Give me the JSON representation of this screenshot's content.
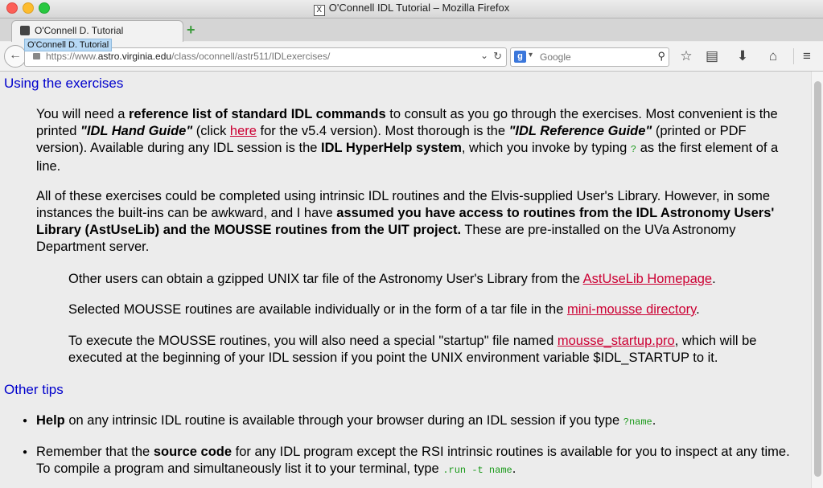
{
  "window": {
    "title": "O'Connell IDL Tutorial – Mozilla Firefox"
  },
  "tab": {
    "label": "O'Connell D. Tutorial",
    "tooltip": "O'Connell D. Tutorial"
  },
  "nav": {
    "url_prefix": "https://www.",
    "url_domain": "astro.virginia.edu",
    "url_path": "/class/oconnell/astr511/IDLexercises/",
    "search_placeholder": "Google"
  },
  "content": {
    "section1_title": "Using the exercises",
    "p1": {
      "a": "You will need a ",
      "b": "reference list of standard IDL commands",
      "c": " to consult as you go through the exercises. Most convenient is the printed ",
      "d": "\"IDL Hand Guide\"",
      "e": " (click ",
      "link": "here",
      "f": " for the v5.4 version). Most thorough is the ",
      "g": "\"IDL Reference Guide\"",
      "h": " (printed or PDF version). Available during any IDL session is the ",
      "i": "IDL HyperHelp system",
      "j": ", which you invoke by typing ",
      "code": "?",
      "k": " as the first element of a line."
    },
    "p2": {
      "a": "All of these exercises could be completed using intrinsic IDL routines and the Elvis-supplied User's Library. However, in some instances the built-ins can be awkward, and I have ",
      "b": "assumed you have access to routines from the IDL Astronomy Users' Library (AstUseLib) and the MOUSSE routines from the UIT project.",
      "c": " These are pre-installed on the UVa Astronomy Department server."
    },
    "s1": {
      "a": "Other users can obtain a gzipped UNIX tar file of the Astronomy User's Library from the ",
      "link": "AstUseLib Homepage",
      "b": "."
    },
    "s2": {
      "a": "Selected MOUSSE routines are available individually or in the form of a tar file in the ",
      "link": "mini-mousse directory",
      "b": "."
    },
    "s3": {
      "a": "To execute the MOUSSE routines, you will also need a special \"startup\" file named ",
      "link": "mousse_startup.pro",
      "b": ", which will be executed at the beginning of your IDL session if you point the UNIX environment variable $IDL_STARTUP to it."
    },
    "section2_title": "Other tips",
    "t1": {
      "a": "Help",
      "b": " on any intrinsic IDL routine is available through your browser during an IDL session if you type ",
      "code": "?name",
      "c": "."
    },
    "t2": {
      "a": "Remember that the ",
      "b": "source code",
      "c": " for any IDL program except the RSI intrinsic routines is available for you to inspect at any time. To compile a program and simultaneously list it to your terminal, type ",
      "code": ".run -t name",
      "d": "."
    }
  }
}
